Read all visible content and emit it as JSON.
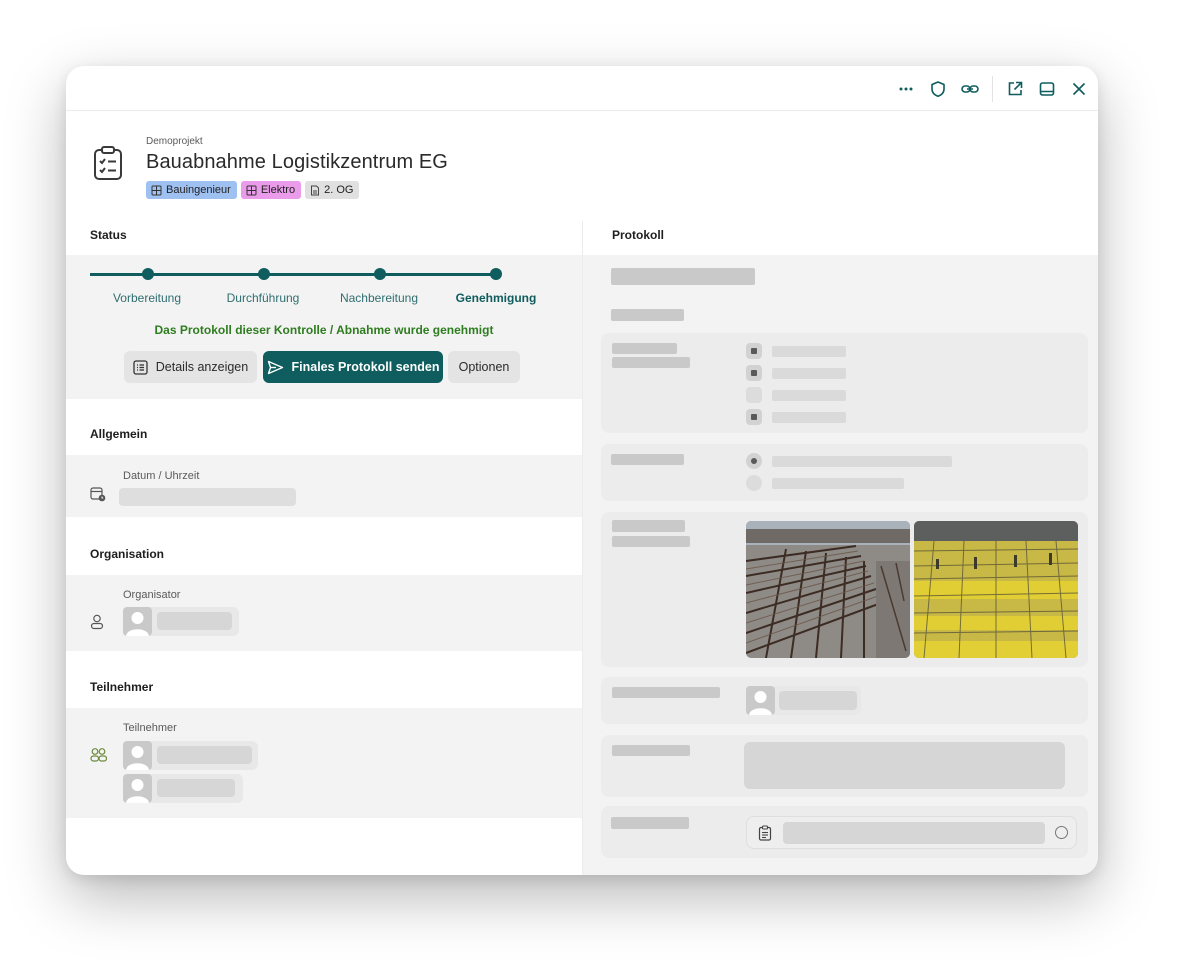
{
  "window": {
    "toolbar_icons": [
      "more-icon",
      "shield-icon",
      "link-icon",
      "open-external-icon",
      "panel-icon",
      "close-icon"
    ]
  },
  "header": {
    "project": "Demoprojekt",
    "title": "Bauabnahme Logistikzentrum EG",
    "icon": "clipboard-check-icon",
    "tags": [
      {
        "label": "Bauingenieur",
        "color": "#9fc1f2",
        "icon": "grid-icon"
      },
      {
        "label": "Elektro",
        "color": "#ea9bea",
        "icon": "grid-icon"
      },
      {
        "label": "2. OG",
        "color": "#e0e0e0",
        "icon": "floorplan-icon"
      }
    ]
  },
  "status": {
    "section_title": "Status",
    "steps": [
      "Vorbereitung",
      "Durchführung",
      "Nachbereitung",
      "Genehmigung"
    ],
    "active_step": "Genehmigung",
    "message": "Das Protokoll dieser Kontrolle / Abnahme wurde genehmigt",
    "buttons": {
      "details": "Details anzeigen",
      "send": "Finales Protokoll senden",
      "options": "Optionen"
    }
  },
  "general": {
    "section_title": "Allgemein",
    "date_label": "Datum / Uhrzeit",
    "date_icon": "calendar-clock-icon"
  },
  "organisation": {
    "section_title": "Organisation",
    "organizer_label": "Organisator",
    "organizer_icon": "user-icon"
  },
  "participants": {
    "section_title": "Teilnehmer",
    "participants_label": "Teilnehmer",
    "participants_icon": "users-icon"
  },
  "protocol": {
    "section_title": "Protokoll",
    "photos": [
      "rebar-cages-photo",
      "yellow-rebar-grid-photo"
    ],
    "checklist_icon": "clipboard-icon",
    "colors": {
      "accent": "#0f5d5e",
      "success": "#2e7d1f"
    }
  }
}
